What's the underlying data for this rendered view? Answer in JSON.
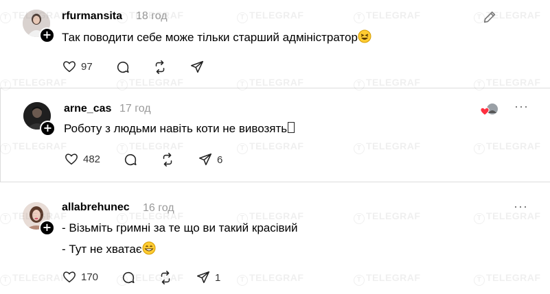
{
  "watermark": "TELEGRAF",
  "posts": [
    {
      "username": "rfurmansita",
      "time": "18 год",
      "lines": [
        "Так поводити себе може тільки старший адміністратор"
      ],
      "likes": "97",
      "comments": "",
      "reposts": "",
      "shares": "",
      "corner_icon": "edit-pencil-icon"
    },
    {
      "username": "arne_cas",
      "time": "17 год",
      "lines": [
        "Роботу з людьми навіть коти не вивозять"
      ],
      "likes": "482",
      "comments": "",
      "reposts": "",
      "shares": "6",
      "corner_icon": "more-icon"
    },
    {
      "username": "allabrehunec",
      "time": "16 год",
      "lines": [
        "- Візьміть гримні за те що ви такий красівий",
        "- Тут не хватає"
      ],
      "likes": "170",
      "comments": "",
      "reposts": "",
      "shares": "1",
      "corner_icon": "more-icon"
    }
  ],
  "colors": {
    "heart_liked": "#ff3040",
    "muted": "#999999",
    "divider": "#dcdcdc"
  }
}
